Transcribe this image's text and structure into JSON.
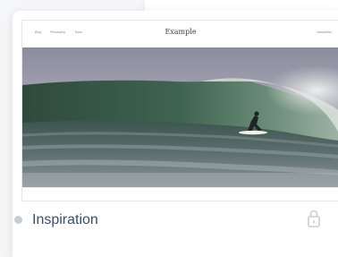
{
  "site": {
    "nav": [
      "Blog",
      "Philosophy",
      "Team"
    ],
    "title": "Example",
    "nav_right": "Newsletter"
  },
  "hero": {
    "image": "surfer-in-barrel-wave"
  },
  "caption": {
    "title": "Inspiration",
    "status_icon": "status-dot",
    "lock_icon": "lock-icon"
  },
  "colors": {
    "title_text": "#3a4f64",
    "dot": "#c6cdd6",
    "lock": "#c9ced5"
  }
}
